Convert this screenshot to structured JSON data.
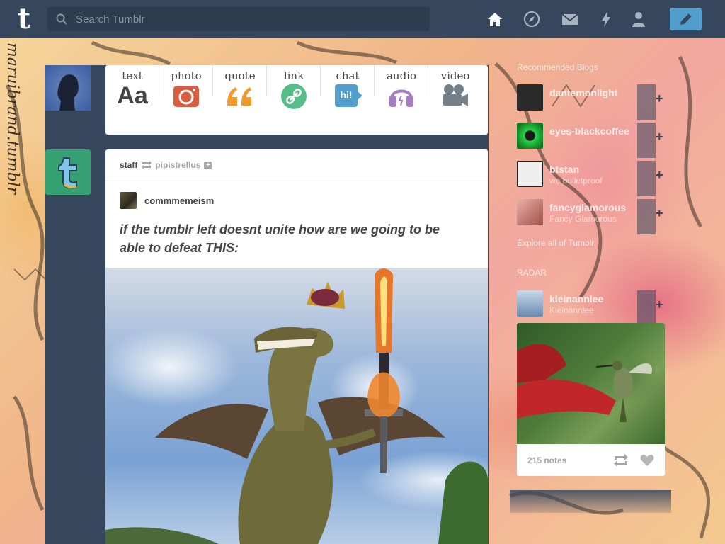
{
  "app": {
    "logo_letter": "t"
  },
  "search": {
    "placeholder": "Search Tumblr"
  },
  "nav": {
    "icons": [
      "home-icon",
      "explore-icon",
      "inbox-icon",
      "activity-icon",
      "account-icon"
    ],
    "compose_icon": "pencil-icon"
  },
  "background": {
    "blog_url": "maruibrand.tumblr"
  },
  "composer": {
    "types": [
      {
        "label": "text",
        "icon": "text-aa-icon",
        "glyph": "Aa",
        "color": "#444444"
      },
      {
        "label": "photo",
        "icon": "camera-icon",
        "color": "#d95e40"
      },
      {
        "label": "quote",
        "icon": "quote-icon",
        "color": "#f2992e"
      },
      {
        "label": "link",
        "icon": "link-icon",
        "color": "#56bc8a"
      },
      {
        "label": "chat",
        "icon": "chat-icon",
        "glyph": "hi!",
        "color": "#529ecc"
      },
      {
        "label": "audio",
        "icon": "headphones-icon",
        "color": "#a77dc2"
      },
      {
        "label": "video",
        "icon": "video-camera-icon",
        "color": "#748089"
      }
    ]
  },
  "post": {
    "author": "staff",
    "source": "pipistrellus",
    "follow_glyph": "+",
    "reblogged_from": "commmemeism",
    "text": "if the tumblr left doesnt unite how are we going to be able to defeat THIS:"
  },
  "sidebar": {
    "heading": "Recommended Blogs",
    "recommended": [
      {
        "name": "dantemonlight",
        "title": "",
        "avatar_color": "#2a2a2a"
      },
      {
        "name": "eyes-blackcoffee",
        "title": "",
        "avatar_color": "#1e8a2a"
      },
      {
        "name": "btstan",
        "title": "we bulletproof",
        "avatar_color": "#e8e8e8"
      },
      {
        "name": "fancyglamorous",
        "title": "Fancy Glamorous",
        "avatar_color": "#c97a7a"
      },
      {
        "name": "kleinannlee",
        "title": "Kleinannlee",
        "avatar_color": "#6a8ab0"
      }
    ],
    "explore_label": "Explore all of Tumblr",
    "radar_heading": "RADAR",
    "radar": {
      "notes": "215 notes",
      "reblog_icon": "reblog-icon",
      "like_icon": "heart-icon"
    }
  },
  "colors": {
    "nav_bg": "#36465d",
    "accent": "#529ecc",
    "card_bg": "#ffffff"
  }
}
